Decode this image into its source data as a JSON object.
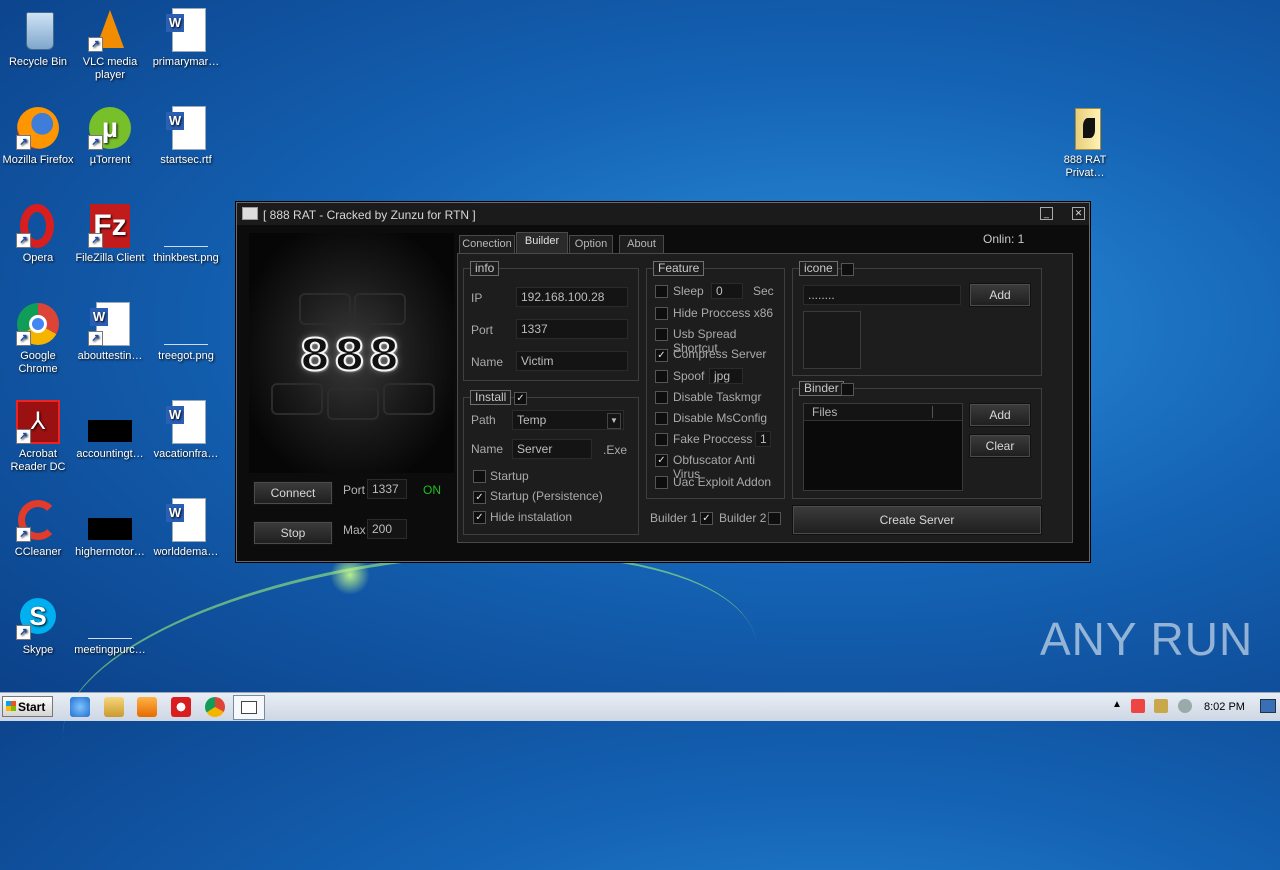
{
  "desktop": {
    "icons": [
      {
        "label": "Recycle Bin",
        "icon": "recycle-bin-icon"
      },
      {
        "label": "VLC media player",
        "icon": "vlc-icon"
      },
      {
        "label": "primarymar…",
        "icon": "word-document-icon"
      },
      {
        "label": "Mozilla Firefox",
        "icon": "firefox-icon"
      },
      {
        "label": "µTorrent",
        "icon": "utorrent-icon"
      },
      {
        "label": "startsec.rtf",
        "icon": "word-document-icon"
      },
      {
        "label": "Opera",
        "icon": "opera-icon"
      },
      {
        "label": "FileZilla Client",
        "icon": "filezilla-icon"
      },
      {
        "label": "thinkbest.png",
        "icon": "image-file-icon"
      },
      {
        "label": "Google Chrome",
        "icon": "chrome-icon"
      },
      {
        "label": "abouttestin…",
        "icon": "word-document-icon"
      },
      {
        "label": "treegot.png",
        "icon": "image-file-icon"
      },
      {
        "label": "Acrobat Reader DC",
        "icon": "acrobat-icon"
      },
      {
        "label": "accountingt…",
        "icon": "black-file-icon"
      },
      {
        "label": "vacationfra…",
        "icon": "word-document-icon"
      },
      {
        "label": "CCleaner",
        "icon": "ccleaner-icon"
      },
      {
        "label": "highermotor…",
        "icon": "black-file-icon"
      },
      {
        "label": "worlddema…",
        "icon": "word-document-icon"
      },
      {
        "label": "Skype",
        "icon": "skype-icon"
      },
      {
        "label": "meetingpurc…",
        "icon": "image-file-icon"
      },
      {
        "label": "888 RAT Privat…",
        "icon": "folder-icon"
      }
    ]
  },
  "window": {
    "title": "[ 888 RAT - Cracked by Zunzu for RTN ]",
    "minimize": "_",
    "close": "✕",
    "logo": "888",
    "connect_label": "Connect",
    "stop_label": "Stop",
    "port_label": "Port",
    "port_value": "1337",
    "status": "ON",
    "max_label": "Max",
    "max_value": "200",
    "online_label": "Onlin: 1",
    "tabs": [
      "Conection",
      "Builder",
      "Option",
      "About"
    ],
    "info": {
      "title": "info",
      "ip_label": "IP",
      "ip_value": "192.168.100.28",
      "port_label": "Port",
      "port_value": "1337",
      "name_label": "Name",
      "name_value": "Victim"
    },
    "install": {
      "title": "Install",
      "path_label": "Path",
      "path_value": "Temp",
      "name_label": "Name",
      "name_value": "Server",
      "ext": ".Exe",
      "startup": "Startup",
      "startup_persist": "Startup (Persistence)",
      "hide_install": "Hide instalation"
    },
    "feature": {
      "title": "Feature",
      "sleep": "Sleep",
      "sleep_value": "0",
      "sleep_unit": "Sec",
      "hide_process": "Hide Proccess x86",
      "usb_spread": "Usb Spread Shortcut",
      "compress": "Compress Server",
      "spoof": "Spoof",
      "spoof_value": "jpg",
      "disable_taskmgr": "Disable Taskmgr",
      "disable_msconfig": "Disable MsConfig",
      "fake_process": "Fake Proccess",
      "fake_value": "1",
      "obfuscator": "Obfuscator Anti Virus",
      "uac": "Uac Exploit Addon"
    },
    "builder1": "Builder 1",
    "builder2": "Builder 2",
    "icone": {
      "title": "icone",
      "path": "........",
      "add": "Add"
    },
    "binder": {
      "title": "Binder",
      "column": "Files",
      "add": "Add",
      "clear": "Clear"
    },
    "create_server": "Create Server"
  },
  "taskbar": {
    "start": "Start",
    "time": "8:02 PM"
  },
  "watermark": "ANY RUN"
}
